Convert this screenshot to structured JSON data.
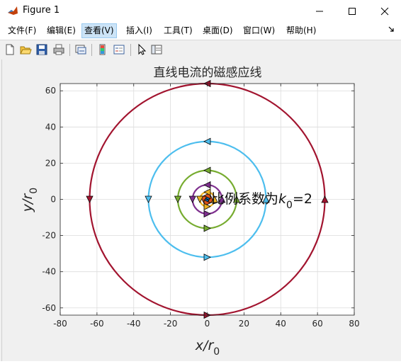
{
  "window": {
    "title": "Figure 1"
  },
  "menu": [
    {
      "label": "文件(F)"
    },
    {
      "label": "编辑(E)"
    },
    {
      "label": "查看(V)"
    },
    {
      "label": "插入(I)"
    },
    {
      "label": "工具(T)"
    },
    {
      "label": "桌面(D)"
    },
    {
      "label": "窗口(W)"
    },
    {
      "label": "帮助(H)"
    }
  ],
  "toolbar": {
    "buttons": [
      "new-figure-icon",
      "open-file-icon",
      "save-icon",
      "print-icon",
      "link-plot-icon",
      "insert-colorbar-icon",
      "insert-legend-icon",
      "pointer-icon",
      "property-inspector-icon"
    ]
  },
  "plot": {
    "title": "直线电流的磁感应线",
    "xlabel_main": "x/r",
    "xlabel_sub": "0",
    "ylabel_main": "y/r",
    "ylabel_sub": "0",
    "annotation_main": "比例系数为",
    "annotation_k": "k",
    "annotation_sub": "0",
    "annotation_val": "=2"
  },
  "chart_data": {
    "type": "line",
    "title": "直线电流的磁感应线",
    "xlabel": "x/r0",
    "ylabel": "y/r0",
    "xlim": [
      -80,
      80
    ],
    "ylim": [
      -64,
      64
    ],
    "xticks": [
      -80,
      -60,
      -40,
      -20,
      0,
      20,
      40,
      60,
      80
    ],
    "yticks": [
      -60,
      -40,
      -20,
      0,
      20,
      40,
      60
    ],
    "grid": true,
    "series": [
      {
        "radius": 1,
        "color": "#0072bd"
      },
      {
        "radius": 2,
        "color": "#d95319"
      },
      {
        "radius": 4,
        "color": "#edb120"
      },
      {
        "radius": 8,
        "color": "#7e2f8e"
      },
      {
        "radius": 16,
        "color": "#77ac30"
      },
      {
        "radius": 32,
        "color": "#4dbeee"
      },
      {
        "radius": 64,
        "color": "#a2142f"
      }
    ],
    "annotation": "比例系数为k0=2"
  }
}
